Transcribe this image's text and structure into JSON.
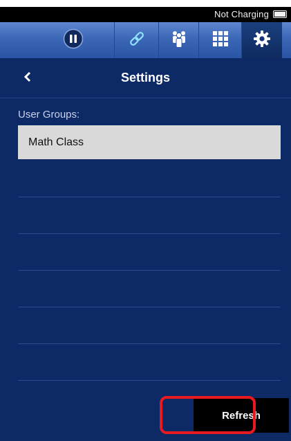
{
  "status_bar": {
    "charging_text": "Not Charging"
  },
  "tabs": [
    {
      "name": "pause",
      "active": false
    },
    {
      "name": "link",
      "active": false
    },
    {
      "name": "group",
      "active": false
    },
    {
      "name": "grid",
      "active": false
    },
    {
      "name": "settings",
      "active": true
    }
  ],
  "nav": {
    "title": "Settings"
  },
  "content": {
    "section_label": "User Groups:",
    "groups": [
      "Math Class"
    ],
    "empty_rows": 6
  },
  "footer": {
    "refresh_label": "Refresh"
  },
  "colors": {
    "background": "#0d2a66",
    "tab_bar": "#3c67b6",
    "selected_row": "#d9d9d9",
    "highlight": "#e8191f"
  }
}
